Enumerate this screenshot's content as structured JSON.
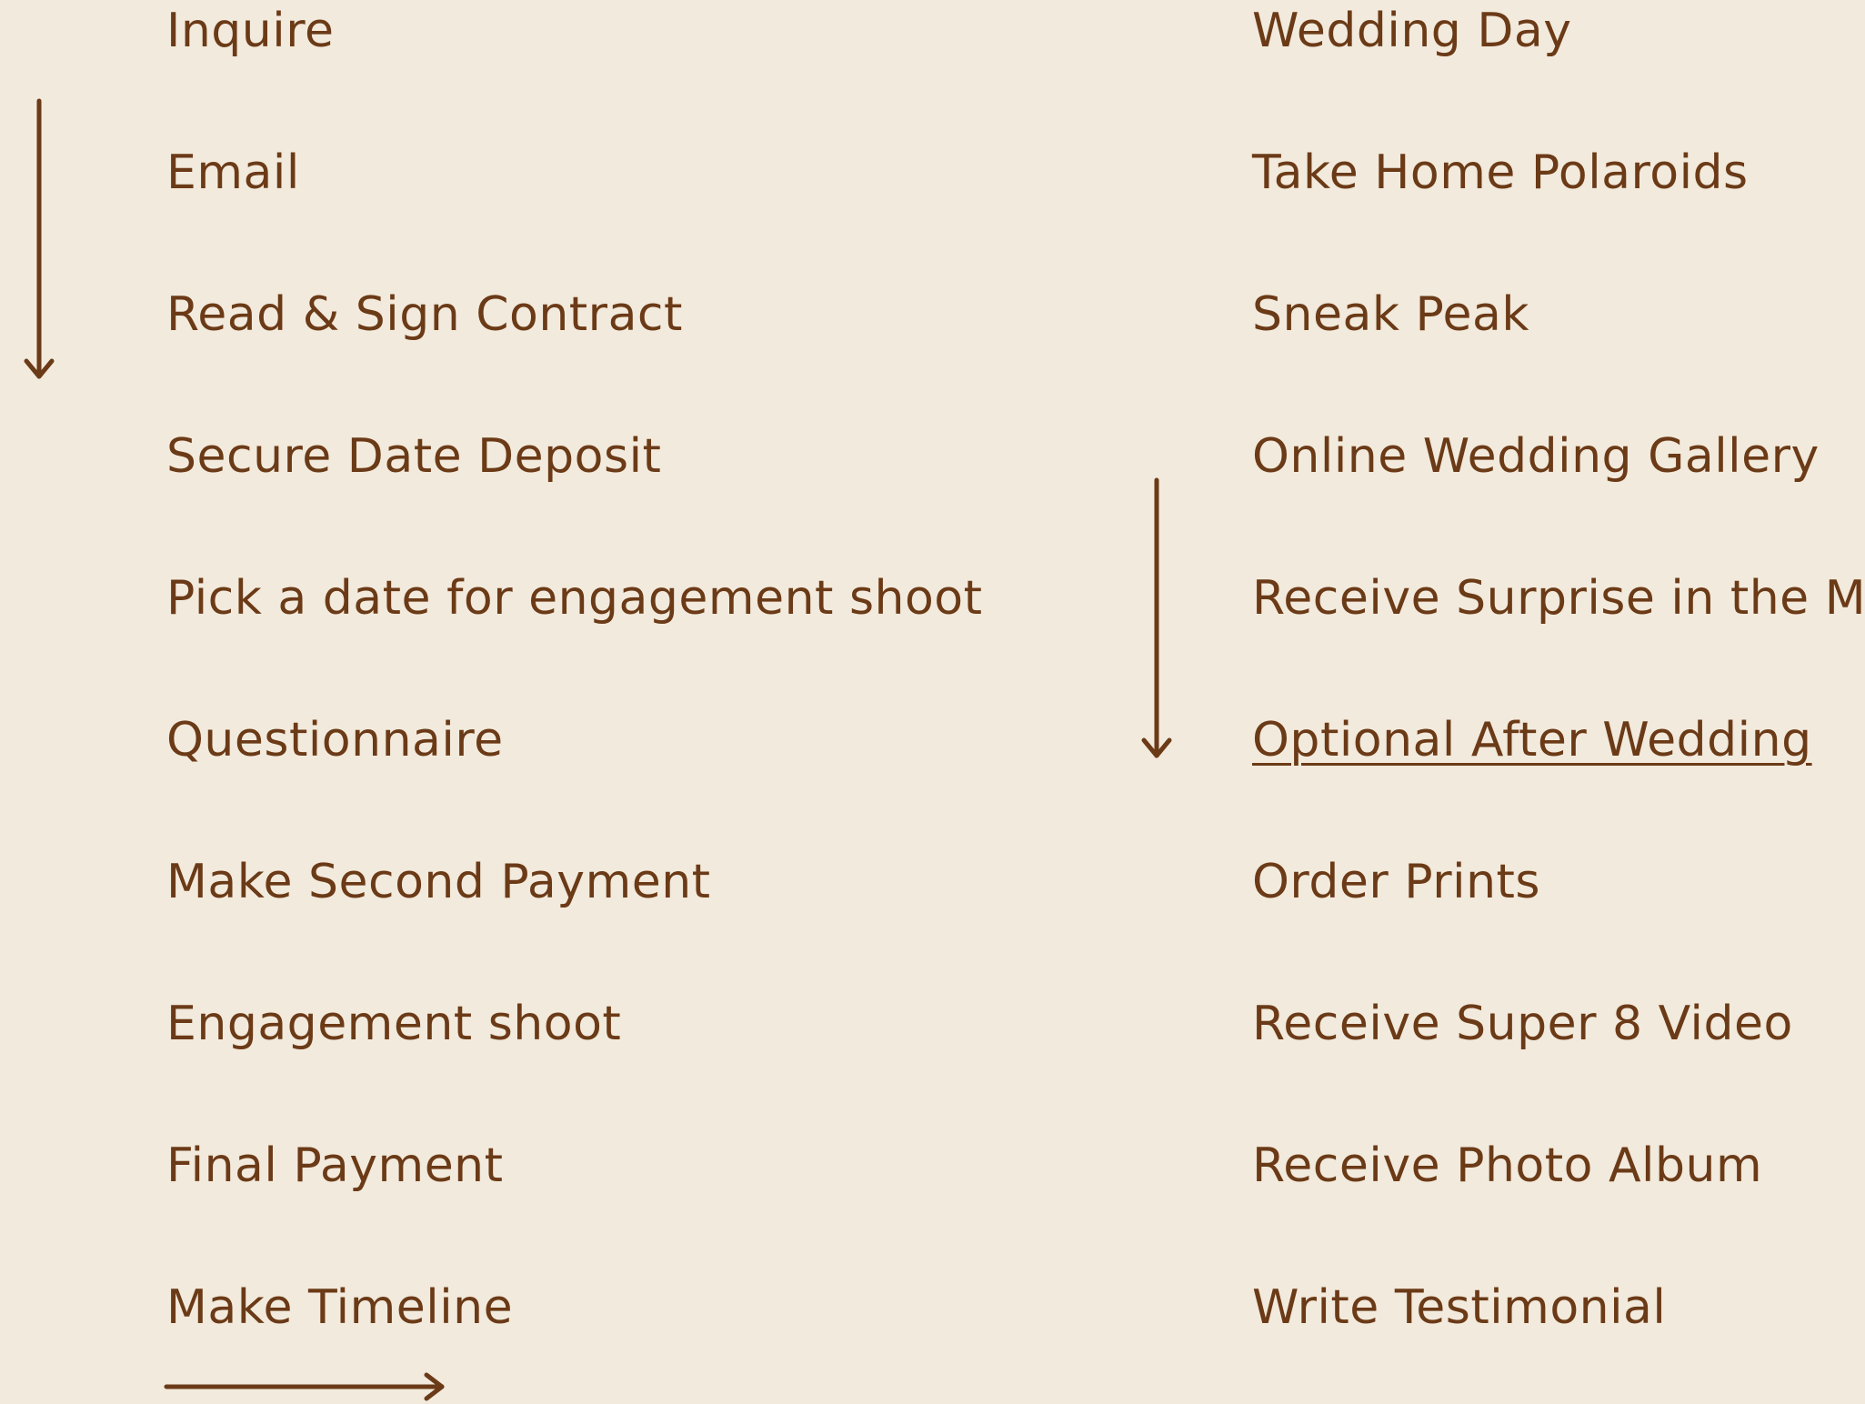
{
  "left_column": {
    "steps": [
      "Inquire",
      "Email",
      "Read & Sign Contract",
      "Secure Date Deposit",
      "Pick a date for engagement shoot",
      "Questionnaire",
      "Make Second Payment",
      "Engagement shoot",
      "Final Payment",
      "Make Timeline"
    ]
  },
  "right_column": {
    "steps": [
      "Wedding Day",
      "Take Home Polaroids",
      "Sneak Peak",
      "Online Wedding Gallery",
      "Receive Surprise in the Mail",
      "Optional After Wedding",
      "Order Prints",
      "Receive Super 8 Video",
      "Receive Photo Album",
      "Write Testimonial"
    ]
  },
  "colors": {
    "background": "#f2eadc",
    "text": "#6b3a17"
  },
  "icons": [
    "arrow-down-icon",
    "arrow-down-icon",
    "arrow-right-icon"
  ]
}
